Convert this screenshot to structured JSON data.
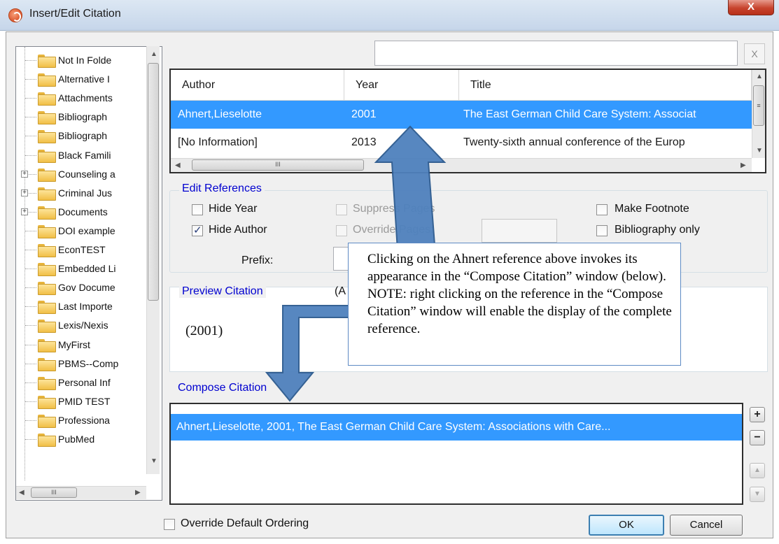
{
  "window": {
    "title": "Insert/Edit Citation",
    "close_label": "X"
  },
  "colors": {
    "accent": "#3399ff",
    "group_label": "#0000d0",
    "callout_arrow": "#4a7ec0"
  },
  "folders": [
    {
      "label": "Not In Folde",
      "expandable": false
    },
    {
      "label": "Alternative I",
      "expandable": false
    },
    {
      "label": "Attachments",
      "expandable": false
    },
    {
      "label": "Bibliograph",
      "expandable": false
    },
    {
      "label": "Bibliograph",
      "expandable": false
    },
    {
      "label": "Black Famili",
      "expandable": false
    },
    {
      "label": "Counseling a",
      "expandable": true
    },
    {
      "label": "Criminal Jus",
      "expandable": true
    },
    {
      "label": "Documents",
      "expandable": true
    },
    {
      "label": "DOI example",
      "expandable": false
    },
    {
      "label": "EconTEST",
      "expandable": false
    },
    {
      "label": "Embedded Li",
      "expandable": false
    },
    {
      "label": "Gov Docume",
      "expandable": false
    },
    {
      "label": "Last Importe",
      "expandable": false
    },
    {
      "label": "Lexis/Nexis",
      "expandable": false
    },
    {
      "label": "MyFirst",
      "expandable": false
    },
    {
      "label": "PBMS--Comp",
      "expandable": false
    },
    {
      "label": "Personal Inf",
      "expandable": false
    },
    {
      "label": "PMID TEST",
      "expandable": false
    },
    {
      "label": "Professiona",
      "expandable": false
    },
    {
      "label": "PubMed",
      "expandable": false
    }
  ],
  "search": {
    "value": "",
    "placeholder": "",
    "clear_label": "X"
  },
  "references": {
    "columns": [
      "Author",
      "Year",
      "Title"
    ],
    "rows": [
      {
        "author": "Ahnert,Lieselotte",
        "year": "2001",
        "title": "The East German Child Care System: Associat",
        "selected": true
      },
      {
        "author": "[No Information]",
        "year": "2013",
        "title": "Twenty-sixth annual conference of the Europ",
        "selected": false
      }
    ]
  },
  "edit_references": {
    "label": "Edit References",
    "hide_year": {
      "label": "Hide Year",
      "checked": false
    },
    "hide_author": {
      "label": "Hide Author",
      "checked": true
    },
    "suppress_pages": {
      "label": "Suppress Pages",
      "checked": false,
      "enabled": false
    },
    "override_pages": {
      "label": "Override Pages:",
      "checked": false,
      "enabled": false
    },
    "make_footnote": {
      "label": "Make Footnote",
      "checked": false
    },
    "bibliography_only": {
      "label": "Bibliography only",
      "checked": false
    },
    "prefix_label": "Prefix:",
    "prefix_value": ""
  },
  "preview": {
    "label": "Preview Citation",
    "extra": "(A",
    "text": "(2001)"
  },
  "compose": {
    "label": "Compose Citation",
    "items": [
      "Ahnert,Lieselotte, 2001, The East German Child Care System: Associations with Care..."
    ]
  },
  "side_buttons": {
    "add": "+",
    "remove": "−",
    "up": "▲",
    "down": "▼"
  },
  "override_ordering": {
    "label": "Override Default Ordering",
    "checked": false
  },
  "buttons": {
    "ok": "OK",
    "cancel": "Cancel"
  },
  "callout": {
    "text": "Clicking on the Ahnert reference above invokes its appearance in the “Compose Citation” window (below).  NOTE: right clicking on the reference in the “Compose Citation” window will enable the display of the complete reference."
  }
}
